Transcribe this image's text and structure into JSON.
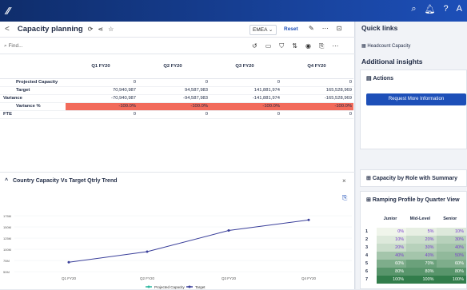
{
  "app": {
    "logo": "⁄⁄"
  },
  "topbar": {
    "icons": [
      "search-icon",
      "bell-icon",
      "help-icon",
      "user-initial"
    ],
    "glyphs": [
      "⌕",
      "🔔︎",
      "?",
      "A"
    ]
  },
  "header": {
    "back": "<",
    "title": "Capacity planning",
    "region": "EMEA ⌄",
    "reset": "Reset"
  },
  "toolbar": {
    "find_placeholder": "Find..."
  },
  "grid": {
    "columns": [
      "Q1 FY20",
      "Q2 FY20",
      "Q3 FY20",
      "Q4 FY20"
    ],
    "rows": [
      {
        "label": "Projected Capacity",
        "values": [
          "0",
          "0",
          "0",
          "0"
        ],
        "indent": true
      },
      {
        "label": "Target",
        "values": [
          "70,940,987",
          "94,587,983",
          "141,881,974",
          "165,528,969"
        ],
        "indent": true
      },
      {
        "label": "Variance",
        "values": [
          "-70,940,987",
          "-94,587,983",
          "-141,881,974",
          "-165,528,969"
        ],
        "indent": false
      },
      {
        "label": "Variance %",
        "values": [
          "-100.0%",
          "-100.0%",
          "-100.0%",
          "-100.0%"
        ],
        "indent": true,
        "highlight": true
      },
      {
        "label": "FTE",
        "values": [
          "0",
          "0",
          "0",
          "0"
        ],
        "indent": false
      }
    ]
  },
  "chart_data": {
    "type": "line",
    "title": "Country Capacity Vs Target Qtrly Trend",
    "categories": [
      "Q1 FY20",
      "Q2 FY20",
      "Q3 FY20",
      "Q4 FY20"
    ],
    "yticks": [
      "50M",
      "75M",
      "100M",
      "125M",
      "150M",
      "175M"
    ],
    "ylim": [
      50000000,
      175000000
    ],
    "series": [
      {
        "name": "Projected Capacity",
        "values": [
          0,
          0,
          0,
          0
        ],
        "color": "#2fb8a0"
      },
      {
        "name": "Target",
        "values": [
          70940987,
          94587983,
          141881974,
          165528969
        ],
        "color": "#3a3f9a"
      }
    ],
    "legend": "bottom"
  },
  "right": {
    "quick_links": "Quick links",
    "headcount_link": "Headcount Capacity",
    "additional_insights": "Additional insights",
    "actions": "Actions",
    "request_btn": "Request More Information",
    "capacity_role": "Capacity by Role with Summary",
    "ramping": "Ramping Profile by Quarter View",
    "ramp_cols": [
      "Junior",
      "Mid-Level",
      "Senior"
    ],
    "ramp_rows": [
      [
        "1",
        "0%",
        "5%",
        "10%"
      ],
      [
        "2",
        "10%",
        "20%",
        "30%"
      ],
      [
        "3",
        "20%",
        "30%",
        "40%"
      ],
      [
        "4",
        "40%",
        "40%",
        "50%"
      ],
      [
        "5",
        "60%",
        "70%",
        "60%"
      ],
      [
        "6",
        "80%",
        "80%",
        "80%"
      ],
      [
        "7",
        "100%",
        "100%",
        "100%"
      ]
    ]
  }
}
